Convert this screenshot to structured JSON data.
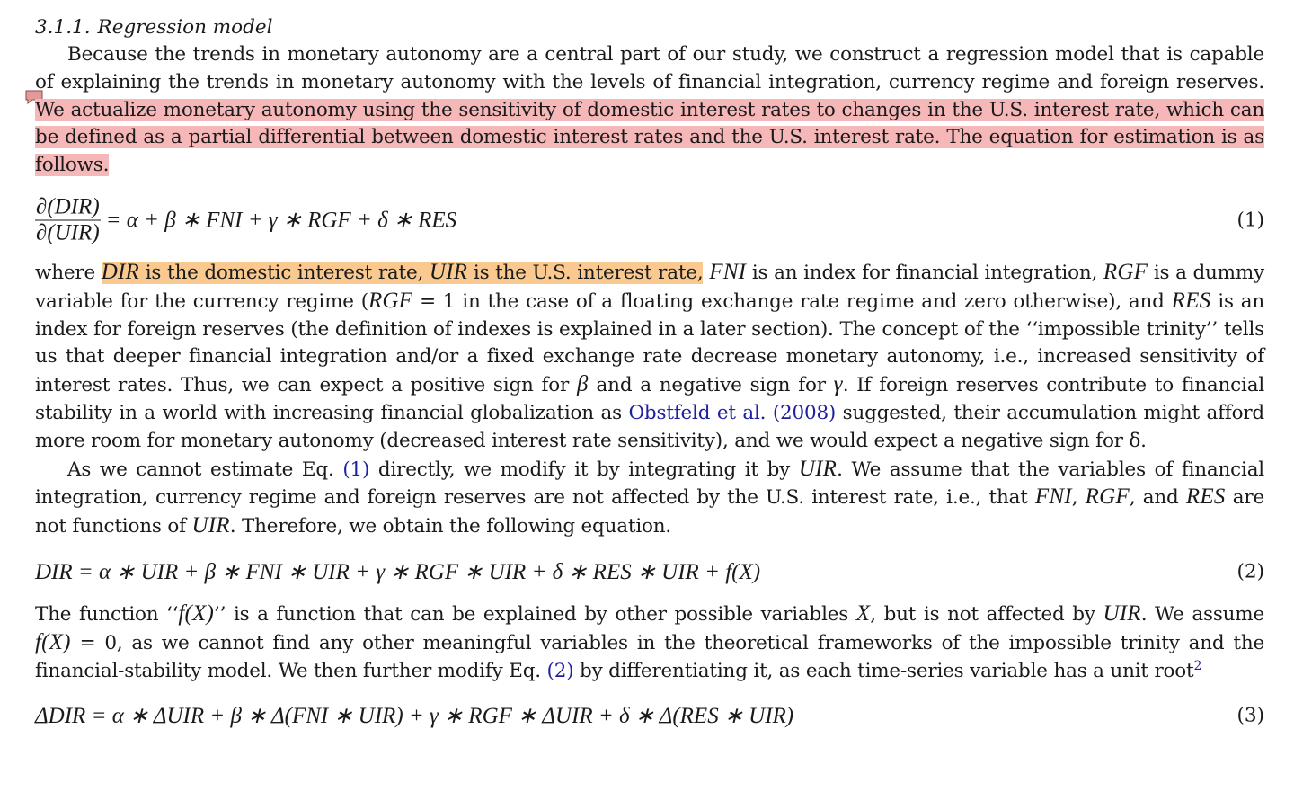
{
  "section": {
    "number": "3.1.1.",
    "title": "Regression model"
  },
  "p1": {
    "plain": "Because the trends in monetary autonomy are a central part of our study, we construct a regression model that is capable of explaining the trends in monetary autonomy with the levels of financial integration, currency regime and foreign reserves. ",
    "highlighted": "We actualize monetary autonomy using the sensitivity of domestic interest rates to changes in the U.S. interest rate, which can be defined as a partial differential between domestic interest rates and the U.S. interest rate. The equation for estimation is as follows."
  },
  "eq1": {
    "numerator": "∂(DIR)",
    "denominator": "∂(UIR)",
    "rhs": "= α + β ∗ FNI + γ ∗ RGF + δ ∗ RES",
    "number": "(1)"
  },
  "p2": {
    "where": "where ",
    "hl_a1": "DIR",
    "hl_a2": " is the domestic interest rate, ",
    "hl_a3": "UIR",
    "hl_a4": " is the U.S. interest rate,",
    "t1": " ",
    "v_fni": "FNI",
    "t2": " is an index for financial integration, ",
    "v_rgf": "RGF",
    "t3": " is a dummy variable for the currency regime (",
    "v_rgf2": "RGF",
    "t4": " = 1 in the case of a floating exchange rate regime and zero otherwise), and ",
    "v_res": "RES",
    "t5": " is an index for foreign reserves (the definition of indexes is explained in a later section). The concept of the ‘‘impossible trinity’’ tells us that deeper financial integration and/or a fixed exchange rate decrease monetary autonomy, i.e., increased sensitivity of interest rates. Thus, we can expect a positive sign for ",
    "v_beta": "β",
    "t6": " and a negative sign for ",
    "v_gamma": "γ",
    "t7": ". If foreign reserves contribute to financial stability in a world with increasing financial globalization as ",
    "link": "Obstfeld et al. (2008)",
    "t8": " suggested, their accumulation might afford more room for monetary autonomy (decreased interest rate sensitivity), and we would expect a negative sign for δ."
  },
  "p3": {
    "t1": "As we cannot estimate Eq. ",
    "ref1": "(1)",
    "t2": " directly, we modify it by integrating it by ",
    "v_uir": "UIR",
    "t3": ". We assume that the variables of financial integration, currency regime and foreign reserves are not affected by the U.S. interest rate, i.e., that ",
    "v_fni": "FNI",
    "c1": ", ",
    "v_rgf": "RGF",
    "c2": ", and ",
    "v_res": "RES",
    "t4": " are not functions of ",
    "v_uir2": "UIR",
    "t5": ". Therefore, we obtain the following equation."
  },
  "eq2": {
    "expr": "DIR = α ∗ UIR + β ∗  FNI  ∗ UIR + γ ∗ RGF ∗ UIR + δ ∗ RES ∗ UIR +  f(X)",
    "number": "(2)"
  },
  "p4": {
    "t1": "The function ‘‘",
    "fx": "f(X)",
    "t2": "’’ is a function that can be explained by other possible variables ",
    "vx": "X",
    "t3": ", but is not affected by ",
    "v_uir": "UIR",
    "t4": ". We assume ",
    "fx2": "f(X)",
    "t5": " = 0, as we cannot find any other meaningful variables in the theoretical frameworks of the impossible trinity and the financial-stability model. We then further modify Eq. ",
    "ref2": "(2)",
    "t6": " by differentiating it, as each time-series variable has a unit root",
    "fn": "2"
  },
  "eq3": {
    "expr": "ΔDIR = α ∗ ΔUIR + β ∗ Δ(FNI ∗ UIR) + γ ∗ RGF ∗ ΔUIR + δ ∗ Δ(RES ∗ UIR)",
    "number": "(3)"
  },
  "colors": {
    "highlight_red": "#f6b7b9",
    "highlight_orange": "#f9c98f",
    "link": "#1f1fa0"
  }
}
